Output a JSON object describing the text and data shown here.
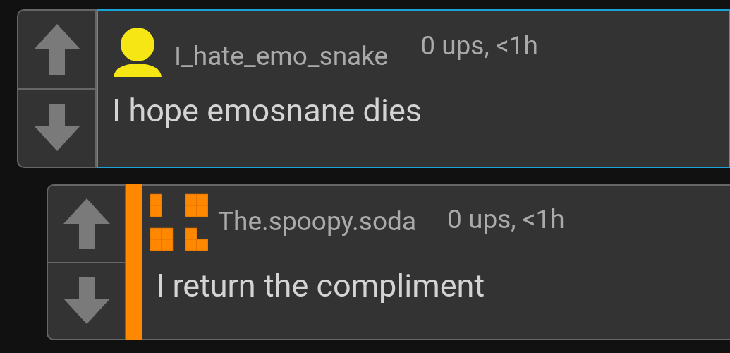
{
  "comments": [
    {
      "username": "I_hate_emo_snake",
      "meta": "0 ups, <1h",
      "text": "I hope emosnane dies",
      "avatar": {
        "kind": "person",
        "color": "#f5e614"
      },
      "selected": true,
      "accent_bar": false,
      "children": [
        {
          "username": "The.spoopy.soda",
          "meta": "0 ups, <1h",
          "text": "I return the compliment",
          "avatar": {
            "kind": "blocks",
            "color": "#ff8800"
          },
          "selected": false,
          "accent_bar": true
        }
      ]
    }
  ]
}
